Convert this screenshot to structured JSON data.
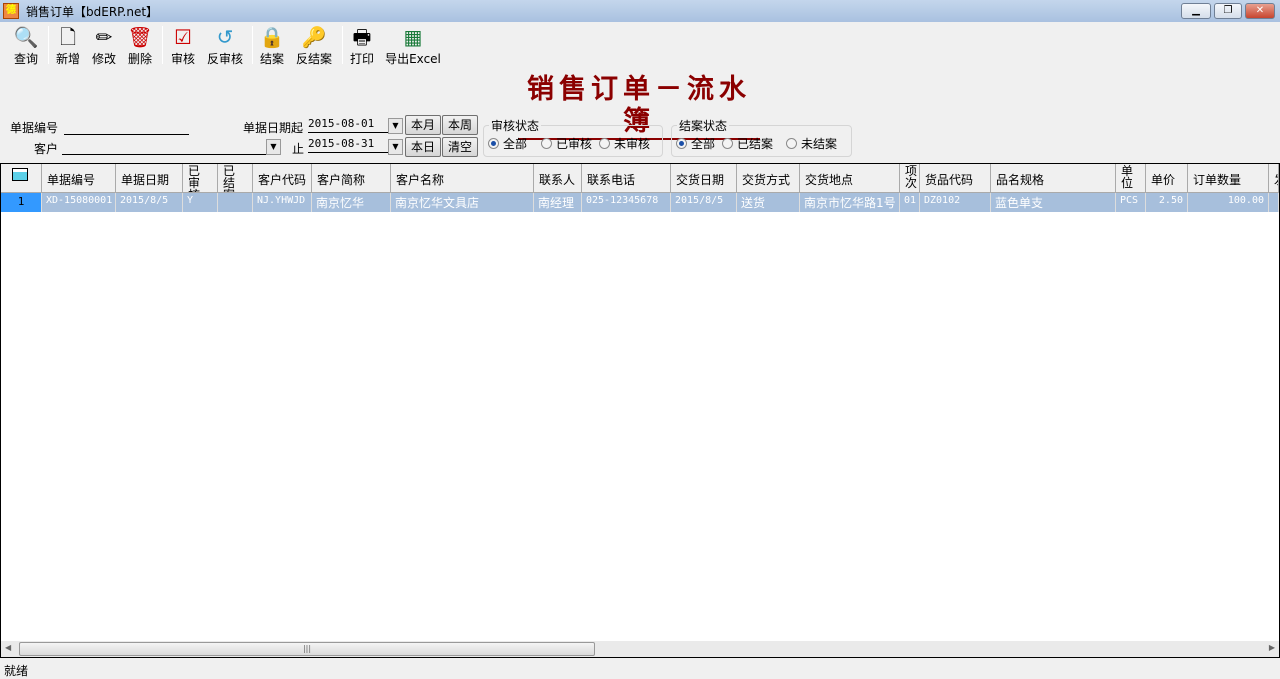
{
  "window": {
    "title": "销售订单【bdERP.net】",
    "app_icon": "bd-logo-icon",
    "controls": [
      "minimize",
      "restore",
      "close"
    ]
  },
  "toolbar": [
    {
      "label": "查询",
      "icon": "search-magnifier-icon"
    },
    {
      "label": "新增",
      "icon": "new-document-icon"
    },
    {
      "label": "修改",
      "icon": "edit-pencil-icon"
    },
    {
      "label": "删除",
      "icon": "trash-icon"
    },
    {
      "label": "审核",
      "icon": "clipboard-check-icon"
    },
    {
      "label": "反审核",
      "icon": "clipboard-undo-icon"
    },
    {
      "label": "结案",
      "icon": "lock-icon"
    },
    {
      "label": "反结案",
      "icon": "key-icon"
    },
    {
      "label": "打印",
      "icon": "printer-icon"
    },
    {
      "label": "导出Excel",
      "icon": "excel-icon"
    }
  ],
  "page_title": "销售订单－流水簿",
  "filters": {
    "doc_no_label": "单据编号",
    "doc_no_value": "",
    "customer_label": "客户",
    "customer_value": "",
    "date_from_label": "单据日期起",
    "date_from": "2015-08-01",
    "date_to_label": "止",
    "date_to": "2015-08-31",
    "btn_month": "本月",
    "btn_week": "本周",
    "btn_today": "本日",
    "btn_clear": "清空",
    "audit_group": "审核状态",
    "audit_options": [
      "全部",
      "已审核",
      "未审核"
    ],
    "audit_selected": "全部",
    "close_group": "结案状态",
    "close_options": [
      "全部",
      "已结案",
      "未结案"
    ],
    "close_selected": "全部"
  },
  "grid": {
    "columns": [
      "单据编号",
      "单据日期",
      "已审核",
      "已结案",
      "客户代码",
      "客户简称",
      "客户名称",
      "联系人",
      "联系电话",
      "交货日期",
      "交货方式",
      "交货地点",
      "项次",
      "货品代码",
      "品名规格",
      "单位",
      "单价",
      "订单数量",
      "发"
    ],
    "rows": [
      {
        "index": "1",
        "cells": [
          "XD-15080001",
          "2015/8/5",
          "Y",
          "",
          "NJ.YHWJD",
          "南京忆华",
          "南京忆华文具店",
          "南经理",
          "025-12345678",
          "2015/8/5",
          "送货",
          "南京市忆华路1号",
          "01",
          "DZ0102",
          "蓝色单支",
          "PCS",
          "2.50",
          "100.00",
          ""
        ]
      }
    ],
    "selection_color": "#a7bfdc"
  },
  "status": "就绪"
}
